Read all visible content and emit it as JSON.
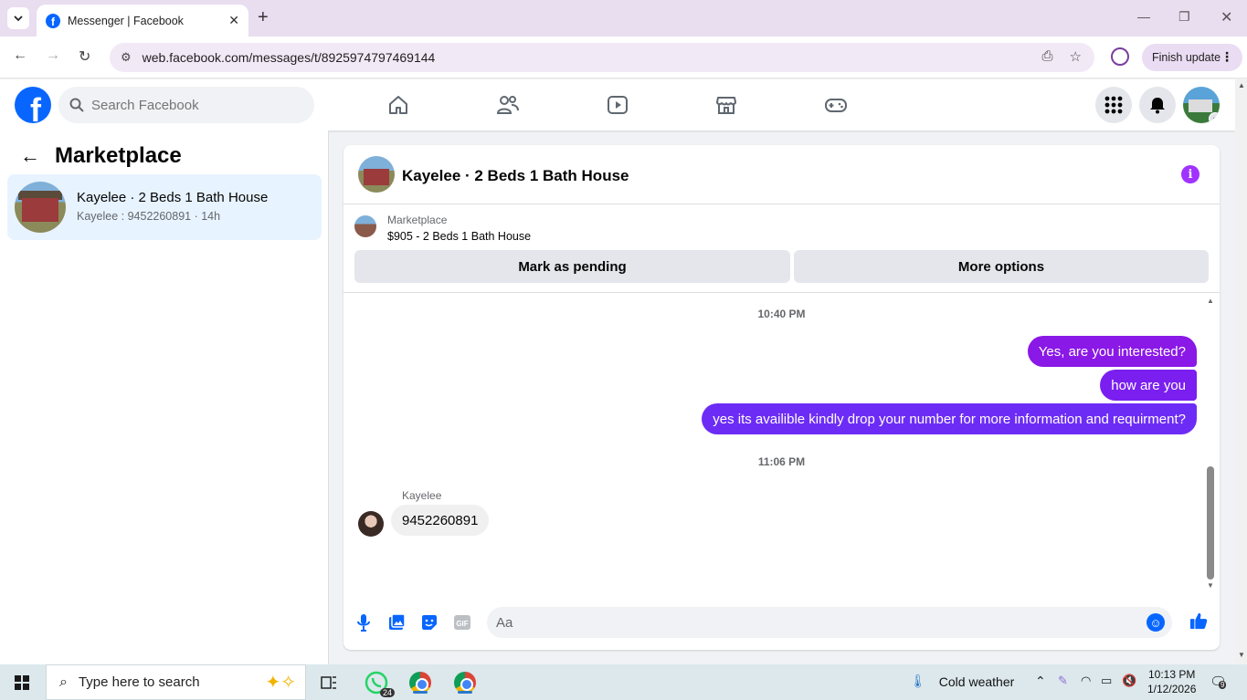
{
  "browser": {
    "tab_title": "Messenger | Facebook",
    "url": "web.facebook.com/messages/t/8925974797469144",
    "finish_update_label": "Finish update"
  },
  "fb_header": {
    "logo_letter": "f",
    "search_placeholder": "Search Facebook",
    "nav_icons": [
      "home-icon",
      "friends-icon",
      "watch-icon",
      "marketplace-icon",
      "gaming-icon"
    ]
  },
  "sidebar": {
    "title": "Marketplace",
    "conversations": [
      {
        "name": "Kayelee · 2 Beds 1 Bath House",
        "preview": "Kayelee : 9452260891 · 14h"
      }
    ]
  },
  "chat": {
    "title": "Kayelee · 2 Beds 1 Bath House",
    "listing": {
      "label": "Marketplace",
      "price_title": "$905 - 2 Beds 1 Bath House"
    },
    "actions": {
      "mark_pending": "Mark as pending",
      "more_options": "More options"
    },
    "timestamps": [
      "10:40 PM",
      "11:06 PM"
    ],
    "outgoing": [
      "Yes, are you interested?",
      "how are you",
      "yes its availible kindly drop your number for more information and requirment?"
    ],
    "incoming": {
      "sender": "Kayelee",
      "text": "9452260891"
    },
    "composer": {
      "placeholder": "Aa"
    },
    "colors": {
      "accent": "#7f1df3",
      "info": "#a033ff"
    }
  },
  "taskbar": {
    "search_placeholder": "Type here to search",
    "whatsapp_badge": "24",
    "weather": "Cold weather",
    "time": "10:13 PM",
    "date": "1/12/2026",
    "notifications": "9"
  }
}
